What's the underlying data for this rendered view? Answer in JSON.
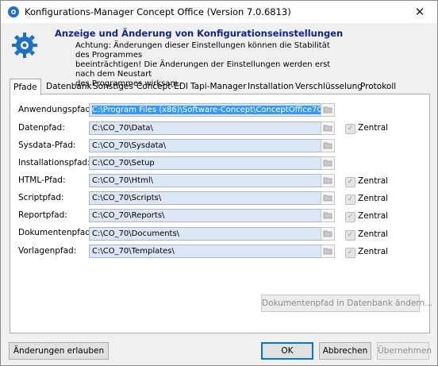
{
  "window": {
    "title": "Konfigurations-Manager Concept Office (Version 7.0.6813)",
    "close_glyph": "✕"
  },
  "header": {
    "title": "Anzeige und Änderung von Konfigurationseinstellungen",
    "warning": "Achtung: Änderungen dieser Einstellungen können die Stabilität des Programmes\nbeeinträchtigen! Die Änderungen der Einstellungen werden erst nach dem Neustart\ndes Programmes wirksam."
  },
  "tabs": [
    "Pfade",
    "Datenbank",
    "Sonstiges",
    "Concept-EDI",
    "Tapi-Manager",
    "Installation",
    "Verschlüsselung",
    "Protokoll"
  ],
  "rows": [
    {
      "label": "Anwendungspfad:",
      "value": "C:\\Program Files (x86)\\Software-Concept\\ConceptOffice70",
      "zentral": false
    },
    {
      "label": "Datenpfad:",
      "value": "C:\\CO_70\\Data\\",
      "zentral": true
    },
    {
      "label": "Sysdata-Pfad:",
      "value": "C:\\CO_70\\Sysdata\\",
      "zentral": false
    },
    {
      "label": "Installationspfad:",
      "value": "C:\\CO_70\\Setup",
      "zentral": false
    },
    {
      "label": "HTML-Pfad:",
      "value": "C:\\CO_70\\Html\\",
      "zentral": true
    },
    {
      "label": "Scriptpfad:",
      "value": "C:\\CO_70\\Scripts\\",
      "zentral": true
    },
    {
      "label": "Reportpfad:",
      "value": "C:\\CO_70\\Reports\\",
      "zentral": true
    },
    {
      "label": "Dokumentenpfad:",
      "value": "C:\\CO_70\\Documents\\",
      "zentral": true
    },
    {
      "label": "Vorlagenpfad:",
      "value": "C:\\CO_70\\Templates\\",
      "zentral": true
    }
  ],
  "zentral_label": "Zentral",
  "buttons": {
    "doc_path_db": "Dokumentenpfad in Datenbank ändern...",
    "allow_changes": "Änderungen erlauben",
    "ok": "OK",
    "cancel": "Abbrechen",
    "apply": "Übernehmen"
  },
  "colors": {
    "title_blue": "#12248a",
    "field_bg": "#dce6f4",
    "selection": "#3399ff"
  }
}
